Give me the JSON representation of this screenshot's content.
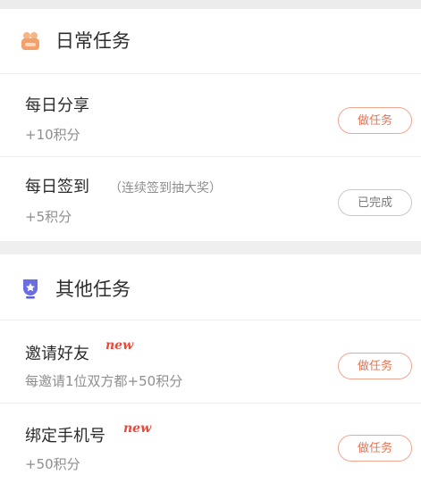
{
  "sections": [
    {
      "title": "日常任务",
      "icon": "gift-icon",
      "tasks": [
        {
          "title": "每日分享",
          "note": "",
          "reward": "+10积分",
          "button": "做任务",
          "status": "todo"
        },
        {
          "title": "每日签到",
          "note": "（连续签到抽大奖）",
          "reward": "+5积分",
          "button": "已完成",
          "status": "done"
        }
      ]
    },
    {
      "title": "其他任务",
      "icon": "medal-icon",
      "tasks": [
        {
          "title": "邀请好友",
          "badge": "new",
          "reward": "每邀请1位双方都+50积分",
          "button": "做任务",
          "status": "todo"
        },
        {
          "title": "绑定手机号",
          "badge": "new",
          "reward": "+50积分",
          "button": "做任务",
          "status": "todo"
        }
      ]
    }
  ],
  "colors": {
    "accent": "#e67455",
    "accent_border": "#f2a58f",
    "new_badge": "#e94a3a",
    "gift_icon": "#f3a06b",
    "medal_icon": "#5b5fd6"
  }
}
